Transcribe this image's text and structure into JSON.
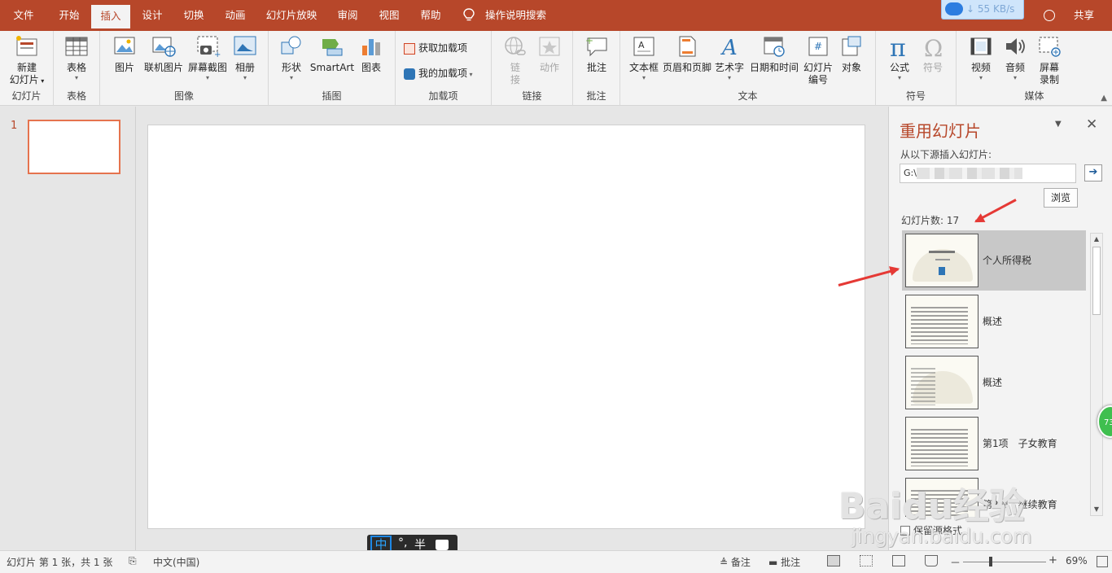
{
  "tabs": [
    {
      "label": "文件",
      "active": false
    },
    {
      "label": "开始",
      "active": false
    },
    {
      "label": "插入",
      "active": true
    },
    {
      "label": "设计",
      "active": false
    },
    {
      "label": "切换",
      "active": false
    },
    {
      "label": "动画",
      "active": false
    },
    {
      "label": "幻灯片放映",
      "active": false
    },
    {
      "label": "审阅",
      "active": false
    },
    {
      "label": "视图",
      "active": false
    },
    {
      "label": "帮助",
      "active": false
    }
  ],
  "tell_me": "操作说明搜索",
  "net_speed": "55 KB/s",
  "share": "共享",
  "ribbon": {
    "groups": {
      "slides": "幻灯片",
      "tables": "表格",
      "images": "图像",
      "illustrations": "插图",
      "addins": "加载项",
      "links": "链接",
      "comments": "批注",
      "text": "文本",
      "symbols": "符号",
      "media": "媒体"
    },
    "buttons": {
      "new_slide_1": "新建",
      "new_slide_2": "幻灯片",
      "table": "表格",
      "pictures": "图片",
      "online_pictures": "联机图片",
      "screenshot": "屏幕截图",
      "album": "相册",
      "shapes": "形状",
      "smartart": "SmartArt",
      "chart": "图表",
      "get_addins": "获取加载项",
      "my_addins": "我的加载项",
      "link_1": "链",
      "link_2": "接",
      "action": "动作",
      "comment": "批注",
      "textbox": "文本框",
      "header_footer": "页眉和页脚",
      "wordart": "艺术字",
      "datetime": "日期和时间",
      "slide_number_1": "幻灯片",
      "slide_number_2": "编号",
      "object": "对象",
      "equation": "公式",
      "symbol": "符号",
      "video": "视频",
      "audio": "音频",
      "screen_recording_1": "屏幕",
      "screen_recording_2": "录制"
    }
  },
  "slide_panel": {
    "slide_number": "1"
  },
  "reuse_pane": {
    "title": "重用幻灯片",
    "insert_from_label": "从以下源插入幻灯片:",
    "source_path": "G:\\",
    "browse": "浏览",
    "slide_count": "幻灯片数: 17",
    "items": [
      {
        "label": "个人所得税",
        "selected": true
      },
      {
        "label": "概述",
        "selected": false
      },
      {
        "label": "概述",
        "selected": false
      },
      {
        "label": "第1项　子女教育",
        "selected": false
      },
      {
        "label": "第2项　继续教育",
        "selected": false
      }
    ],
    "keep_source_formatting": "保留源格式"
  },
  "green_badge": "73",
  "ime": {
    "mode": "中",
    "punct": "°,",
    "width": "半"
  },
  "watermark": {
    "line1": "Baidu经验",
    "line2": "jingyan.baidu.com"
  },
  "status": {
    "slide_info": "幻灯片 第 1 张，共 1 张",
    "language": "中文(中国)",
    "notes": "备注",
    "comments": "批注",
    "zoom": "69%",
    "zoom_minus": "－",
    "zoom_plus": "+"
  }
}
